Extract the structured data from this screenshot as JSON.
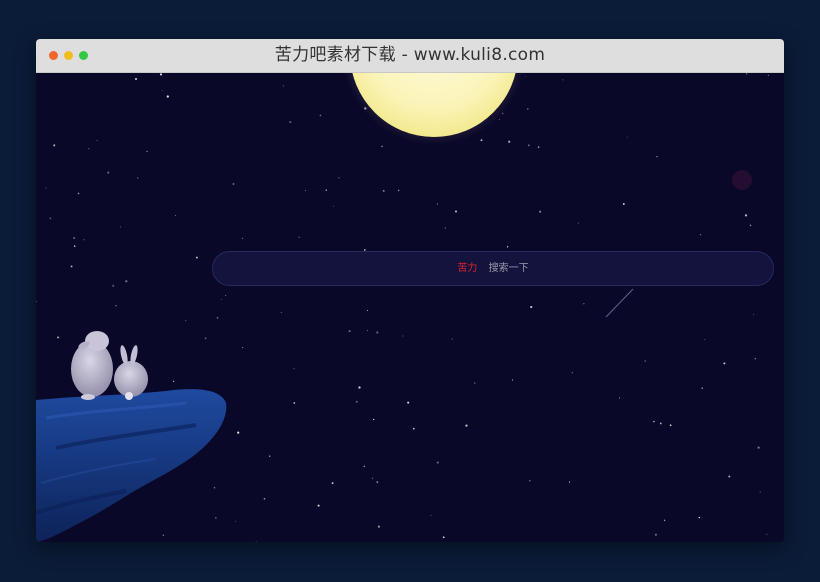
{
  "window": {
    "title": "苦力吧素材下载 - www.kuli8.com",
    "dots": {
      "red": "#f0652b",
      "yellow": "#f0bd1f",
      "green": "#34c748"
    }
  },
  "scene": {
    "background": "#0a0828",
    "moon_color": "#fbf6c4",
    "rock_color": "#173a82"
  },
  "search": {
    "brand": "苦力",
    "placeholder": "搜索一下"
  }
}
